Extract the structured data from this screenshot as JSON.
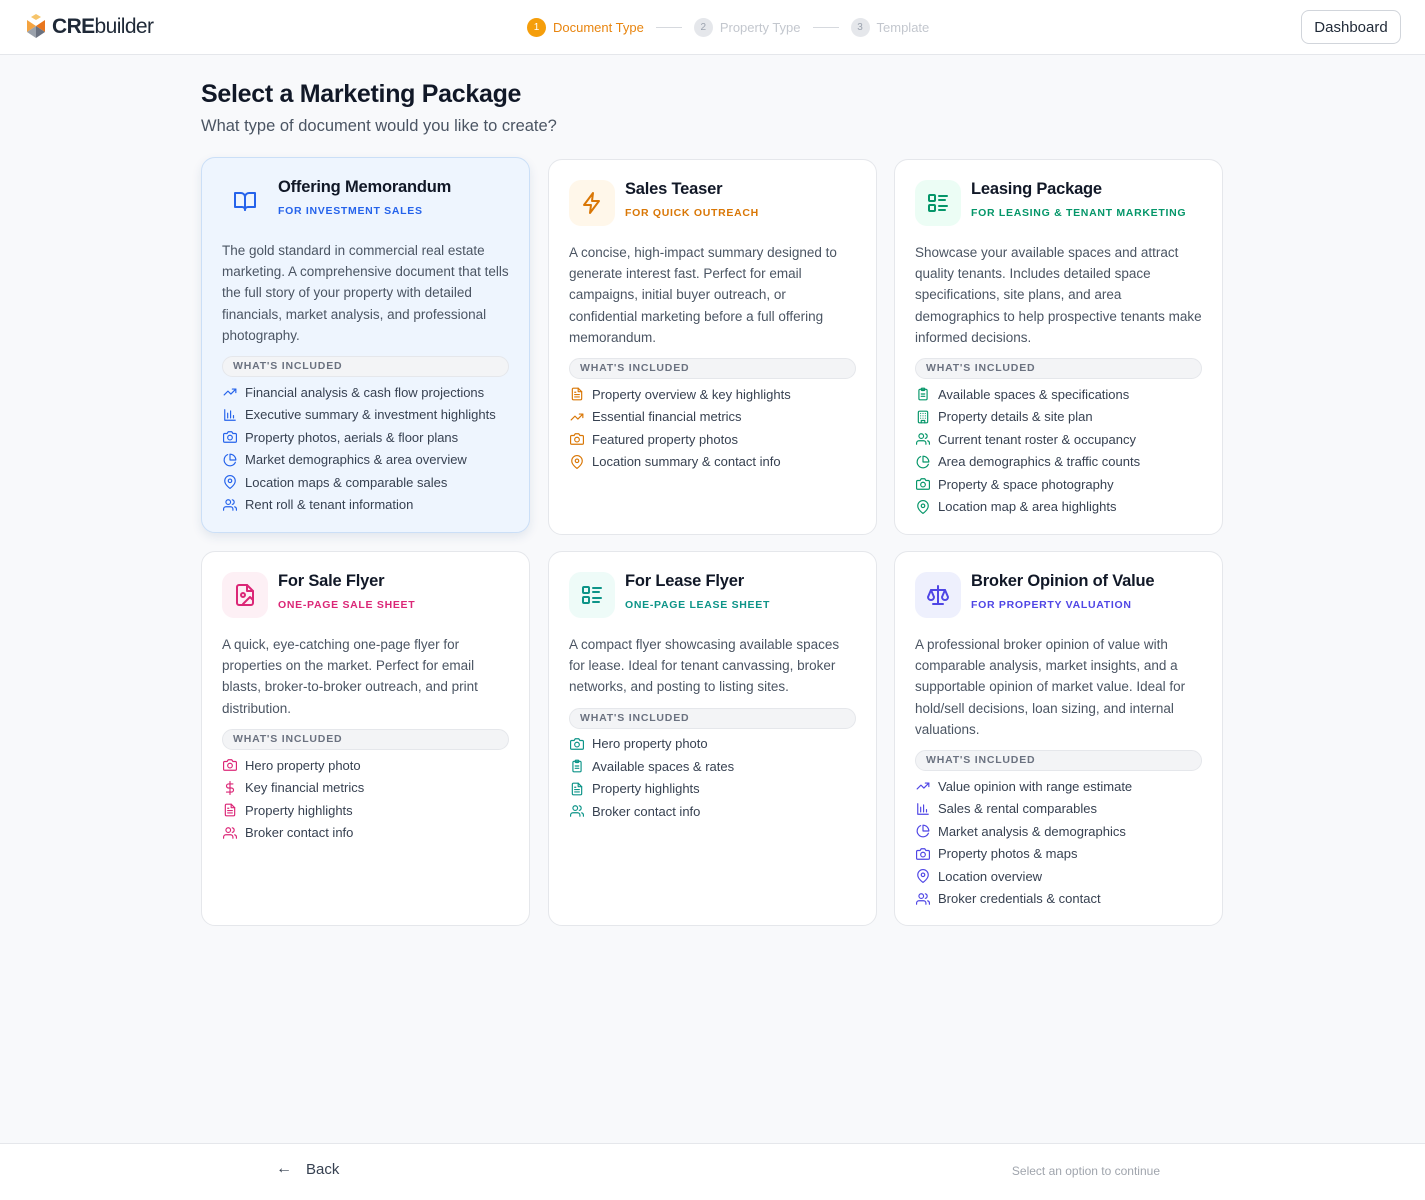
{
  "brand": {
    "name_bold": "CRE",
    "name_rest": "builder"
  },
  "steps": [
    {
      "num": "1",
      "label": "Document Type"
    },
    {
      "num": "2",
      "label": "Property Type"
    },
    {
      "num": "3",
      "label": "Template"
    }
  ],
  "header": {
    "dashboard_label": "Dashboard"
  },
  "page": {
    "title": "Select a Marketing Package",
    "subtitle": "What type of document would you like to create?"
  },
  "colors": {
    "blue": "#2563eb",
    "orange": "#d97706",
    "green": "#059669",
    "pink": "#db2777",
    "teal": "#0d9488",
    "indigo": "#4f46e5"
  },
  "cards": [
    {
      "title": "Offering Memorandum",
      "tag": "FOR INVESTMENT SALES",
      "icon": "book-open-icon",
      "description": "The gold standard in commercial real estate marketing. A comprehensive document that tells the full story of your property with detailed financials, market analysis, and professional photography.",
      "included_label": "WHAT'S INCLUDED",
      "items": [
        {
          "icon": "trending-up-icon",
          "text": "Financial analysis & cash flow projections"
        },
        {
          "icon": "bar-chart-icon",
          "text": "Executive summary & investment highlights"
        },
        {
          "icon": "camera-icon",
          "text": "Property photos, aerials & floor plans"
        },
        {
          "icon": "pie-chart-icon",
          "text": "Market demographics & area overview"
        },
        {
          "icon": "map-pin-icon",
          "text": "Location maps & comparable sales"
        },
        {
          "icon": "users-icon",
          "text": "Rent roll & tenant information"
        }
      ]
    },
    {
      "title": "Sales Teaser",
      "tag": "FOR QUICK OUTREACH",
      "icon": "lightning-icon",
      "description": "A concise, high-impact summary designed to generate interest fast. Perfect for email campaigns, initial buyer outreach, or confidential marketing before a full offering memorandum.",
      "included_label": "WHAT'S INCLUDED",
      "items": [
        {
          "icon": "document-icon",
          "text": "Property overview & key highlights"
        },
        {
          "icon": "trending-up-icon",
          "text": "Essential financial metrics"
        },
        {
          "icon": "camera-icon",
          "text": "Featured property photos"
        },
        {
          "icon": "map-pin-icon",
          "text": "Location summary & contact info"
        }
      ]
    },
    {
      "title": "Leasing Package",
      "tag": "FOR LEASING & TENANT MARKETING",
      "icon": "list-icon",
      "description": "Showcase your available spaces and attract quality tenants. Includes detailed space specifications, site plans, and area demographics to help prospective tenants make informed decisions.",
      "included_label": "WHAT'S INCLUDED",
      "items": [
        {
          "icon": "clipboard-icon",
          "text": "Available spaces & specifications"
        },
        {
          "icon": "building-icon",
          "text": "Property details & site plan"
        },
        {
          "icon": "users-icon",
          "text": "Current tenant roster & occupancy"
        },
        {
          "icon": "pie-chart-icon",
          "text": "Area demographics & traffic counts"
        },
        {
          "icon": "camera-icon",
          "text": "Property & space photography"
        },
        {
          "icon": "map-pin-icon",
          "text": "Location map & area highlights"
        }
      ]
    },
    {
      "title": "For Sale Flyer",
      "tag": "ONE-PAGE SALE SHEET",
      "icon": "file-image-icon",
      "description": "A quick, eye-catching one-page flyer for properties on the market. Perfect for email blasts, broker-to-broker outreach, and print distribution.",
      "included_label": "WHAT'S INCLUDED",
      "items": [
        {
          "icon": "camera-icon",
          "text": "Hero property photo"
        },
        {
          "icon": "dollar-icon",
          "text": "Key financial metrics"
        },
        {
          "icon": "document-icon",
          "text": "Property highlights"
        },
        {
          "icon": "users-icon",
          "text": "Broker contact info"
        }
      ]
    },
    {
      "title": "For Lease Flyer",
      "tag": "ONE-PAGE LEASE SHEET",
      "icon": "list-icon",
      "description": "A compact flyer showcasing available spaces for lease. Ideal for tenant canvassing, broker networks, and posting to listing sites.",
      "included_label": "WHAT'S INCLUDED",
      "items": [
        {
          "icon": "camera-icon",
          "text": "Hero property photo"
        },
        {
          "icon": "clipboard-icon",
          "text": "Available spaces & rates"
        },
        {
          "icon": "document-icon",
          "text": "Property highlights"
        },
        {
          "icon": "users-icon",
          "text": "Broker contact info"
        }
      ]
    },
    {
      "title": "Broker Opinion of Value",
      "tag": "FOR PROPERTY VALUATION",
      "icon": "scale-icon",
      "description": "A professional broker opinion of value with comparable analysis, market insights, and a supportable opinion of market value. Ideal for hold/sell decisions, loan sizing, and internal valuations.",
      "included_label": "WHAT'S INCLUDED",
      "items": [
        {
          "icon": "trending-up-icon",
          "text": "Value opinion with range estimate"
        },
        {
          "icon": "bar-chart-icon",
          "text": "Sales & rental comparables"
        },
        {
          "icon": "pie-chart-icon",
          "text": "Market analysis & demographics"
        },
        {
          "icon": "camera-icon",
          "text": "Property photos & maps"
        },
        {
          "icon": "map-pin-icon",
          "text": "Location overview"
        },
        {
          "icon": "users-icon",
          "text": "Broker credentials & contact"
        }
      ]
    }
  ],
  "footer": {
    "back_label": "Back",
    "hint": "Select an option to continue"
  }
}
